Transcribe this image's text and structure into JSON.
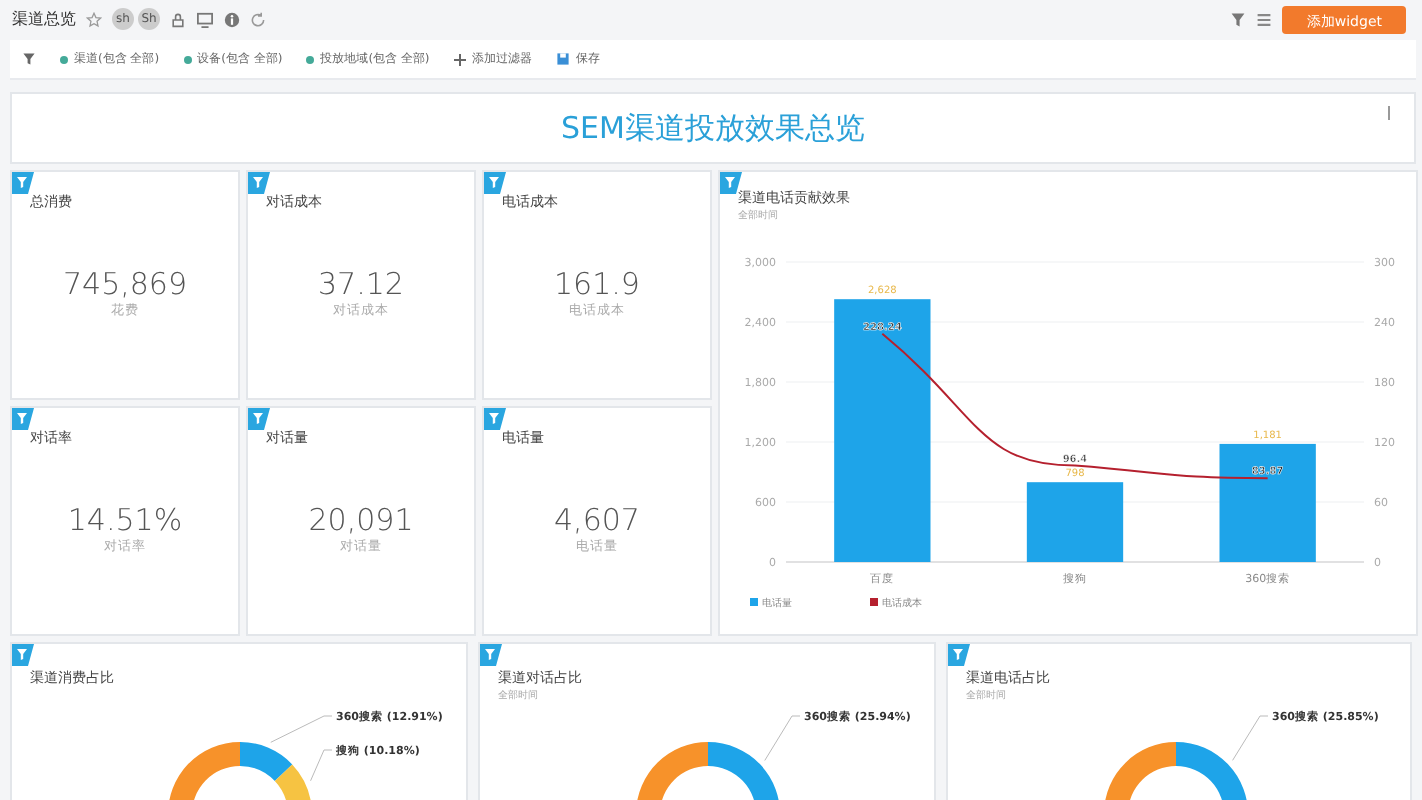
{
  "header": {
    "title": "渠道总览",
    "avatars": [
      "sh",
      "Sh"
    ],
    "add_button": "添加widget"
  },
  "filters": {
    "chips": [
      "渠道(包含 全部)",
      "设备(包含 全部)",
      "投放地域(包含 全部)"
    ],
    "add": "添加过滤器",
    "save": "保存"
  },
  "banner": {
    "title": "SEM渠道投放效果总览"
  },
  "kpis": [
    {
      "title": "总消费",
      "value": "745,869",
      "caption": "花费"
    },
    {
      "title": "对话成本",
      "value": "37.12",
      "caption": "对话成本"
    },
    {
      "title": "电话成本",
      "value": "161.9",
      "caption": "电话成本"
    },
    {
      "title": "对话率",
      "value": "14.51%",
      "caption": "对话率"
    },
    {
      "title": "对话量",
      "value": "20,091",
      "caption": "对话量"
    },
    {
      "title": "电话量",
      "value": "4,607",
      "caption": "电话量"
    }
  ],
  "bar_card": {
    "title": "渠道电话贡献效果",
    "subtitle": "全部时间",
    "chart_data": {
      "type": "bar",
      "categories": [
        "百度",
        "搜狗",
        "360搜索"
      ],
      "series": [
        {
          "name": "电话量",
          "type": "bar",
          "color": "#1ea4e9",
          "values": [
            2628,
            798,
            1181
          ],
          "value_labels": [
            "2,628",
            "798",
            "1,181"
          ]
        },
        {
          "name": "电话成本",
          "type": "line",
          "axis": "y2",
          "color": "#b5202e",
          "values": [
            228.24,
            96.4,
            83.87
          ],
          "value_labels": [
            "228.24",
            "96.4",
            "83.87"
          ]
        }
      ],
      "ylim": [
        0,
        3000
      ],
      "yticks": [
        {
          "value": 0,
          "label": "0"
        },
        {
          "value": 600,
          "label": "600"
        },
        {
          "value": 1200,
          "label": "1,200"
        },
        {
          "value": 1800,
          "label": "1,800"
        },
        {
          "value": 2400,
          "label": "2,400"
        },
        {
          "value": 3000,
          "label": "3,000"
        }
      ],
      "grid": true,
      "legend": "bottom-left",
      "y2lim": [
        0,
        300
      ],
      "y2ticks": [
        0,
        60,
        120,
        180,
        240,
        300
      ]
    }
  },
  "donut_cards": [
    {
      "title": "渠道消费占比",
      "chart_data": {
        "type": "donut",
        "values": [
          12.91,
          10.18,
          76.91
        ],
        "colors": [
          "#1ea4e9",
          "#f6c342",
          "#f7922a"
        ],
        "value_labels": [
          "360搜索 (12.91%)",
          "搜狗 (10.18%)",
          null
        ]
      }
    },
    {
      "title": "渠道对话占比",
      "subtitle": "全部时间",
      "chart_data": {
        "type": "donut",
        "values": [
          25.94,
          74.06
        ],
        "colors": [
          "#1ea4e9",
          "#f7922a"
        ],
        "value_labels": [
          "360搜索 (25.94%)",
          null
        ]
      }
    },
    {
      "title": "渠道电话占比",
      "subtitle": "全部时间",
      "chart_data": {
        "type": "donut",
        "values": [
          25.85,
          74.15
        ],
        "colors": [
          "#1ea4e9",
          "#f7922a"
        ],
        "value_labels": [
          "360搜索 (25.85%)",
          null
        ]
      }
    }
  ]
}
